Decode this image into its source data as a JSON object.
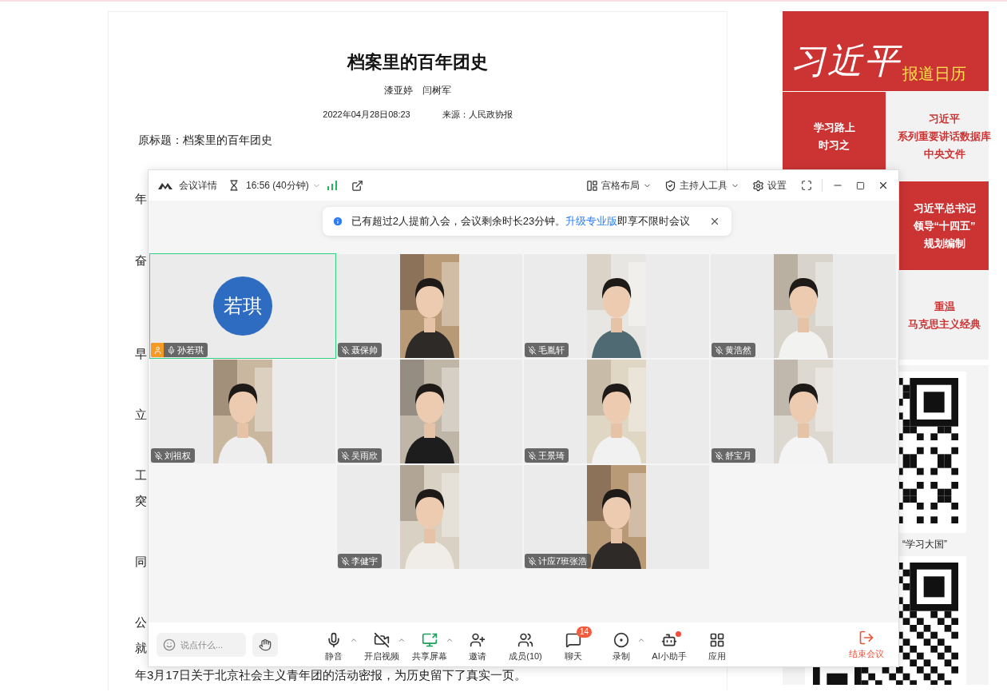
{
  "article": {
    "title": "档案里的百年团史",
    "authors": "漆亚婷　闫树军",
    "date": "2022年04月28日08:23",
    "source": "来源：人民政协报",
    "subtitle": "原标题：档案里的百年团史",
    "fragments": [
      "年",
      "奋",
      "早",
      "立",
      "工",
      "突",
      "同",
      "公",
      "就",
      "年3月17日关于北京社会主义青年团的活动密报，为历史留下了真实一页。"
    ]
  },
  "sidebar": {
    "banner": {
      "logo": "习近平",
      "caption": "报道日历"
    },
    "tiles_left": [
      {
        "kind": "highlight",
        "lines": [
          "学习路上",
          "时习之"
        ]
      }
    ],
    "tiles_right": [
      {
        "kind": "plain",
        "lines": [
          "习近平",
          "系列重要讲话数据库",
          "中央文件"
        ]
      },
      {
        "kind": "highlight",
        "lines": [
          "习近平总书记",
          "领导“十四五”",
          "规划编制"
        ]
      },
      {
        "kind": "plain",
        "lines": [
          "重温",
          "马克思主义经典"
        ]
      }
    ],
    "qr_caption": "“学习大国”"
  },
  "meeting": {
    "title_bar": {
      "details": "会议详情",
      "timer": "16:56 (40分钟)",
      "layout": "宫格布局",
      "host_tools": "主持人工具",
      "settings": "设置"
    },
    "notice": {
      "text": "已有超过2人提前入会，会议剩余时长23分钟。",
      "link": "升级专业版",
      "tail": "即享不限时会议"
    },
    "participants": [
      {
        "kind": "avatar",
        "avatar": "若琪",
        "name": "孙若琪",
        "host": true,
        "muted": false,
        "active": true
      },
      {
        "kind": "video",
        "name": "聂保帅",
        "host": false,
        "muted": true,
        "active": false
      },
      {
        "kind": "video",
        "name": "毛胤轩",
        "host": false,
        "muted": true,
        "active": false
      },
      {
        "kind": "video",
        "name": "黄浩然",
        "host": false,
        "muted": true,
        "active": false
      },
      {
        "kind": "video",
        "name": "刘祖权",
        "host": false,
        "muted": true,
        "active": false
      },
      {
        "kind": "video",
        "name": "吴雨欣",
        "host": false,
        "muted": true,
        "active": false
      },
      {
        "kind": "video",
        "name": "王景琦",
        "host": false,
        "muted": true,
        "active": false
      },
      {
        "kind": "video",
        "name": "舒宝月",
        "host": false,
        "muted": true,
        "active": false
      },
      {
        "kind": "empty"
      },
      {
        "kind": "video",
        "name": "李健宇",
        "host": false,
        "muted": true,
        "active": false
      },
      {
        "kind": "video",
        "name": "计应7班张浩",
        "host": false,
        "muted": true,
        "active": false
      }
    ],
    "chat": {
      "placeholder": "说点什么..."
    },
    "controls": [
      {
        "kind": "mic",
        "label": "静音",
        "menu": true
      },
      {
        "kind": "camera",
        "label": "开启视频",
        "menu": true
      },
      {
        "kind": "share",
        "label": "共享屏幕",
        "menu": true
      },
      {
        "kind": "invite",
        "label": "邀请",
        "menu": false
      },
      {
        "kind": "members",
        "label": "成员(10)",
        "menu": false
      },
      {
        "kind": "chat",
        "label": "聊天",
        "menu": false,
        "badge": "14"
      },
      {
        "kind": "record",
        "label": "录制",
        "menu": true
      },
      {
        "kind": "assistant",
        "label": "AI小助手",
        "menu": false,
        "dot": true
      },
      {
        "kind": "apps",
        "label": "应用",
        "menu": false
      }
    ],
    "end": "结束会议"
  }
}
